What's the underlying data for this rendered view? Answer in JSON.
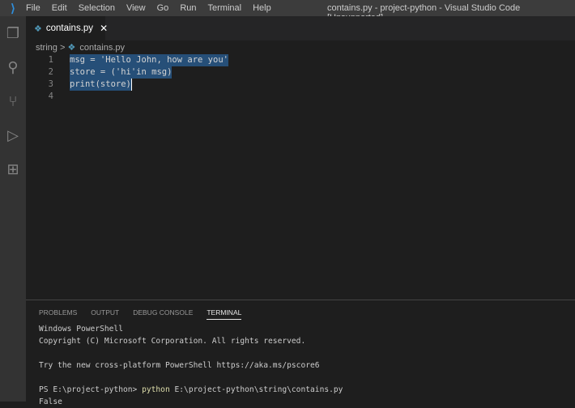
{
  "title_bar": {
    "menu": [
      "File",
      "Edit",
      "Selection",
      "View",
      "Go",
      "Run",
      "Terminal",
      "Help"
    ],
    "window_title": "contains.py - project-python - Visual Studio Code [Unsupported]"
  },
  "tab": {
    "label": "contains.py",
    "close": "✕"
  },
  "breadcrumb": {
    "folder": "string",
    "separator": ">",
    "file": "contains.py"
  },
  "editor": {
    "lines": [
      {
        "n": "1",
        "text": "msg = 'Hello John, how are you'"
      },
      {
        "n": "2",
        "text": "store = ('hi'in msg)"
      },
      {
        "n": "3",
        "text": "print(store)"
      },
      {
        "n": "4",
        "text": ""
      }
    ]
  },
  "panel": {
    "tabs": [
      "PROBLEMS",
      "OUTPUT",
      "DEBUG CONSOLE",
      "TERMINAL"
    ],
    "terminal": {
      "line1": "Windows PowerShell",
      "line2": "Copyright (C) Microsoft Corporation. All rights reserved.",
      "line3": "Try the new cross-platform PowerShell https://aka.ms/pscore6",
      "prompt": "PS E:\\project-python> ",
      "cmd": "python",
      "args": " E:\\project-python\\string\\contains.py",
      "output": "False"
    }
  }
}
